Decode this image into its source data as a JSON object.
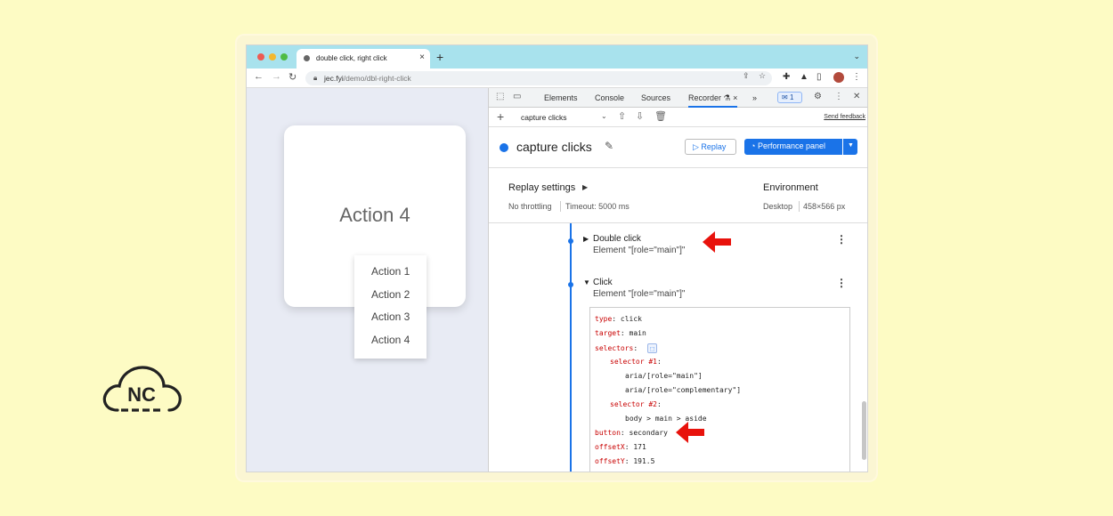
{
  "browser": {
    "tab_title": "double click, right click",
    "tab_close": "×",
    "new_tab": "+",
    "tab_menu": "⌄",
    "url_host": "jec.fyi",
    "url_path": "/demo/dbl-right-click"
  },
  "page": {
    "card_title": "Action 4",
    "context_menu": [
      "Action 1",
      "Action 2",
      "Action 3",
      "Action 4"
    ]
  },
  "devtools": {
    "tabs": [
      "Elements",
      "Console",
      "Sources",
      "Recorder"
    ],
    "recorder_flask": "⚗",
    "recorder_close": "×",
    "more_tabs": "»",
    "message_count": "1",
    "recorder": {
      "recording_select": "capture clicks",
      "send_feedback": "Send feedback",
      "title": "capture clicks",
      "replay_label": "Replay",
      "performance_panel_label": "Performance panel",
      "replay_settings_label": "Replay settings",
      "throttling": "No throttling",
      "timeout": "Timeout: 5000 ms",
      "environment_label": "Environment",
      "device": "Desktop",
      "viewport": "458×566 px",
      "steps": [
        {
          "title": "Double click",
          "subtitle": "Element \"[role=\"main\"]\"",
          "expanded": false
        },
        {
          "title": "Click",
          "subtitle": "Element \"[role=\"main\"]\"",
          "expanded": true
        }
      ],
      "code": {
        "type_key": "type",
        "type_val": "click",
        "target_key": "target",
        "target_val": "main",
        "selectors_key": "selectors",
        "sel1_key": "selector #1",
        "sel1_a": "aria/[role=\"main\"]",
        "sel1_b": "aria/[role=\"complementary\"]",
        "sel2_key": "selector #2",
        "sel2_a": "body > main > aside",
        "button_key": "button",
        "button_val": "secondary",
        "offsetx_key": "offsetX",
        "offsetx_val": "171",
        "offsety_key": "offsetY",
        "offsety_val": "191.5"
      }
    }
  },
  "logo": {
    "text": "NC"
  },
  "colors": {
    "accent": "#1a73e8",
    "arrow": "#e8120c",
    "background": "#fdfbc4"
  }
}
